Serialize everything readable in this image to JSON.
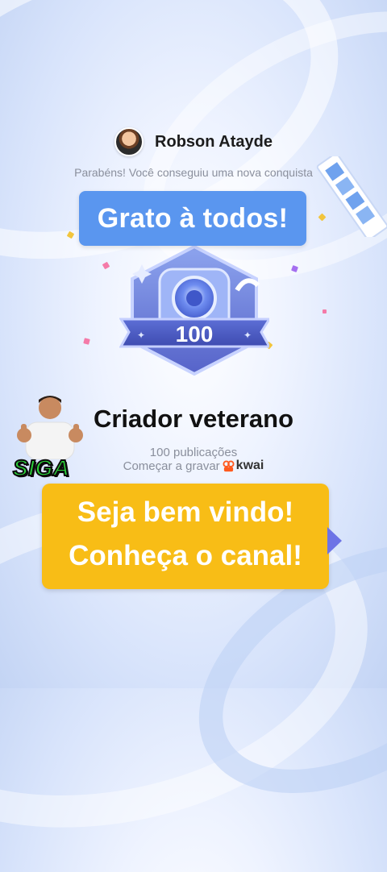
{
  "user": {
    "name": "Robson Atayde",
    "avatar_icon": "avatar-photo"
  },
  "subtitle": "Parabéns! Você conseguiu uma nova conquista",
  "overlay_top": {
    "text": "Grato à todos!",
    "color": "#5a96ef"
  },
  "badge": {
    "number": "100",
    "icon": "camera-badge-icon"
  },
  "achievement": {
    "title": "Criador veterano",
    "description": "100 publicações",
    "start_text": "Começar a gravar",
    "brand": "kwai",
    "brand_color": "#ff5a1f"
  },
  "follow": {
    "label": "SIGA",
    "color": "#2bd13a"
  },
  "overlay_bottom": {
    "line1": "Seja bem vindo!",
    "line2": "Conheça o canal!",
    "color": "#f8bd16"
  }
}
